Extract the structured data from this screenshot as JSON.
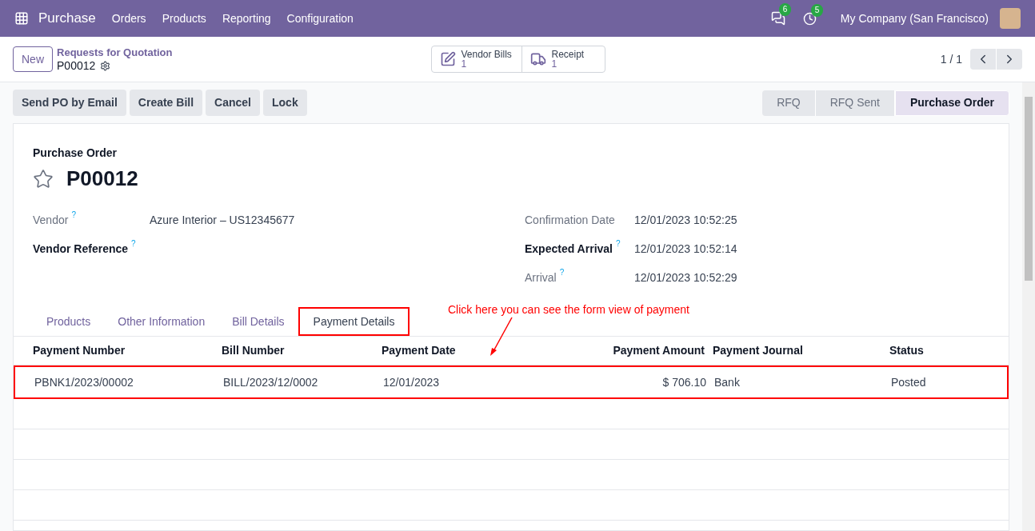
{
  "navbar": {
    "app": "Purchase",
    "menu": [
      "Orders",
      "Products",
      "Reporting",
      "Configuration"
    ],
    "messages_badge": "6",
    "activities_badge": "5",
    "company": "My Company (San Francisco)"
  },
  "control_panel": {
    "new_button": "New",
    "breadcrumb": "Requests for Quotation",
    "record": "P00012",
    "smart_buttons": [
      {
        "kind": "bills",
        "label": "Vendor Bills",
        "count": "1"
      },
      {
        "kind": "receipt",
        "label": "Receipt",
        "count": "1"
      }
    ],
    "pager": "1 / 1"
  },
  "actions": [
    "Send PO by Email",
    "Create Bill",
    "Cancel",
    "Lock"
  ],
  "status_steps": [
    {
      "label": "RFQ",
      "selected": false
    },
    {
      "label": "RFQ Sent",
      "selected": false
    },
    {
      "label": "Purchase Order",
      "selected": true
    }
  ],
  "form": {
    "type_label": "Purchase Order",
    "name": "P00012",
    "starred": false,
    "left_fields": [
      {
        "label": "Vendor",
        "required": false,
        "help": "?",
        "value": "Azure Interior – US12345677"
      },
      {
        "label": "Vendor Reference",
        "required": true,
        "help": "?"
      }
    ],
    "right_fields": [
      {
        "label": "Confirmation Date",
        "required": false,
        "value": "12/01/2023 10:52:25"
      },
      {
        "label": "Expected Arrival",
        "required": true,
        "help": "?",
        "value": "12/01/2023 10:52:14"
      },
      {
        "label": "Arrival",
        "required": false,
        "help": "?",
        "value": "12/01/2023 10:52:29"
      }
    ],
    "tabs": [
      {
        "label": "Products",
        "selected": false
      },
      {
        "label": "Other Information",
        "selected": false
      },
      {
        "label": "Bill Details",
        "selected": false
      },
      {
        "label": "Payment Details",
        "selected": true
      }
    ],
    "table": {
      "columns": [
        "Payment Number",
        "Bill Number",
        "Payment Date",
        "Payment Amount",
        "Payment Journal",
        "Status"
      ],
      "rows": [
        [
          "PBNK1/2023/00002",
          "BILL/2023/12/0002",
          "12/01/2023",
          "$ 706.10",
          "Bank",
          "Posted"
        ]
      ]
    }
  },
  "annotation": "Click here you can see the form view of payment"
}
